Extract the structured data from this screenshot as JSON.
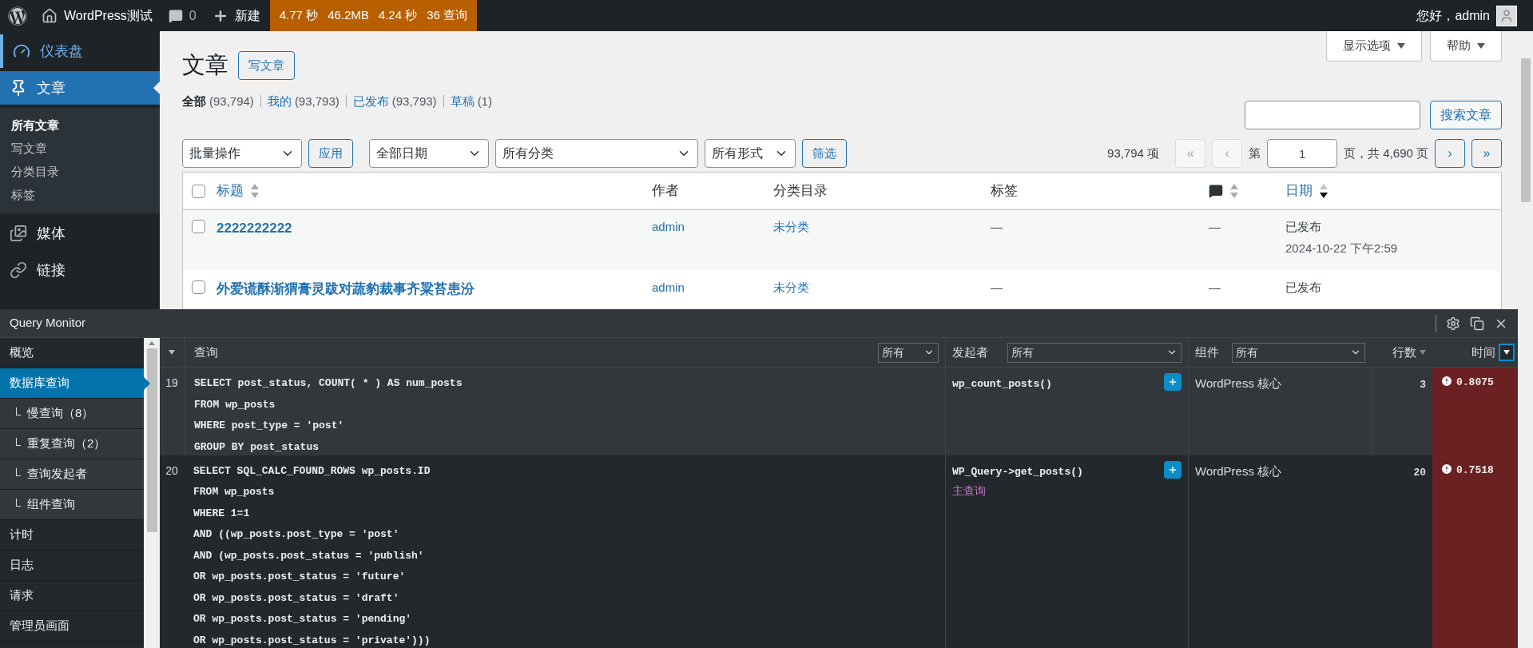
{
  "admin_bar": {
    "site_name": "WordPress测试",
    "comments_count": "0",
    "new_label": "新建",
    "qm_stats": [
      "4.77 秒",
      "46.2MB",
      "4.24 秒",
      "36 查询"
    ],
    "greeting": "您好，admin"
  },
  "menu": [
    {
      "label": "仪表盘",
      "selected": false,
      "hover": true
    },
    {
      "label": "文章",
      "selected": true,
      "hover": false,
      "children": [
        {
          "label": "所有文章",
          "selected": true
        },
        {
          "label": "写文章",
          "selected": false
        },
        {
          "label": "分类目录",
          "selected": false
        },
        {
          "label": "标签",
          "selected": false
        }
      ]
    },
    {
      "label": "媒体",
      "selected": false,
      "hover": false
    },
    {
      "label": "链接",
      "selected": false,
      "hover": false
    }
  ],
  "page": {
    "title": "文章",
    "add_new": "写文章",
    "screen_options": "显示选项",
    "help": "帮助",
    "views": [
      {
        "label": "全部",
        "count": "(93,794)",
        "selected": true
      },
      {
        "label": "我的",
        "count": "(93,793)",
        "selected": false
      },
      {
        "label": "已发布",
        "count": "(93,793)",
        "selected": false
      },
      {
        "label": "草稿",
        "count": "(1)",
        "selected": false
      }
    ],
    "search_button": "搜索文章",
    "bulk_action": "批量操作",
    "apply": "应用",
    "filters": [
      "全部日期",
      "所有分类",
      "所有形式"
    ],
    "filter_button": "筛选",
    "pagination": {
      "total": "93,794 项",
      "first": "«",
      "prev": "‹",
      "page_prefix": "第",
      "current": "1",
      "page_suffix": "页，共 4,690 页",
      "next": "›",
      "last": "»",
      "first_disabled": true,
      "next_disabled": false
    },
    "select_all_checked": false,
    "columns": [
      {
        "label": "标题",
        "kind": "sortable",
        "sorted": false
      },
      {
        "label": "作者",
        "kind": "plain"
      },
      {
        "label": "分类目录",
        "kind": "plain"
      },
      {
        "label": "标签",
        "kind": "plain"
      },
      {
        "kind": "comments",
        "sorted": false
      },
      {
        "label": "日期",
        "kind": "sortable",
        "sorted": true
      }
    ],
    "rows": [
      {
        "title": "2222222222",
        "author": "admin",
        "category": "未分类",
        "tags": "—",
        "comments": "—",
        "status": "已发布",
        "date": "2024-10-22 下午2:59",
        "checked": false
      },
      {
        "title": "外爱谎酥渐猬膏灵跋对蔬豹裁事齐粱苔患汾",
        "author": "admin",
        "category": "未分类",
        "tags": "—",
        "comments": "—",
        "status": "已发布",
        "checked": false
      }
    ]
  },
  "query_monitor": {
    "title": "Query Monitor",
    "nav": [
      {
        "label": "概览",
        "selected": false,
        "sub": false
      },
      {
        "label": "数据库查询",
        "selected": true,
        "sub": false
      },
      {
        "label": "慢查询（8）",
        "selected": false,
        "sub": true
      },
      {
        "label": "重复查询（2）",
        "selected": false,
        "sub": true
      },
      {
        "label": "查询发起者",
        "selected": false,
        "sub": true
      },
      {
        "label": "组件查询",
        "selected": false,
        "sub": true
      },
      {
        "label": "计时",
        "selected": false,
        "sub": false
      },
      {
        "label": "日志",
        "selected": false,
        "sub": false
      },
      {
        "label": "请求",
        "selected": false,
        "sub": false
      },
      {
        "label": "管理员画面",
        "selected": false,
        "sub": false
      }
    ],
    "columns": {
      "query": "查询",
      "query_filter": "所有",
      "caller": "发起者",
      "caller_filter": "所有",
      "component": "组件",
      "component_filter": "所有",
      "rows": "行数",
      "time": "时间"
    },
    "rows": [
      {
        "num": "19",
        "sql": [
          "SELECT post_status, COUNT( * ) AS num_posts",
          "FROM wp_posts",
          "WHERE post_type = 'post'",
          "GROUP BY post_status"
        ],
        "caller": "wp_count_posts()",
        "note": null,
        "component": "WordPress 核心",
        "rows": "3",
        "time": "0.8075",
        "slow": true
      },
      {
        "num": "20",
        "sql": [
          "SELECT SQL_CALC_FOUND_ROWS wp_posts.ID",
          "FROM wp_posts",
          "WHERE 1=1",
          "AND ((wp_posts.post_type = 'post'",
          "AND (wp_posts.post_status = 'publish'",
          "OR wp_posts.post_status = 'future'",
          "OR wp_posts.post_status = 'draft'",
          "OR wp_posts.post_status = 'pending'",
          "OR wp_posts.post_status = 'private')))"
        ],
        "caller": "WP_Query->get_posts()",
        "note": "主查询",
        "component": "WordPress 核心",
        "rows": "20",
        "time": "0.7518",
        "slow": true
      }
    ]
  }
}
